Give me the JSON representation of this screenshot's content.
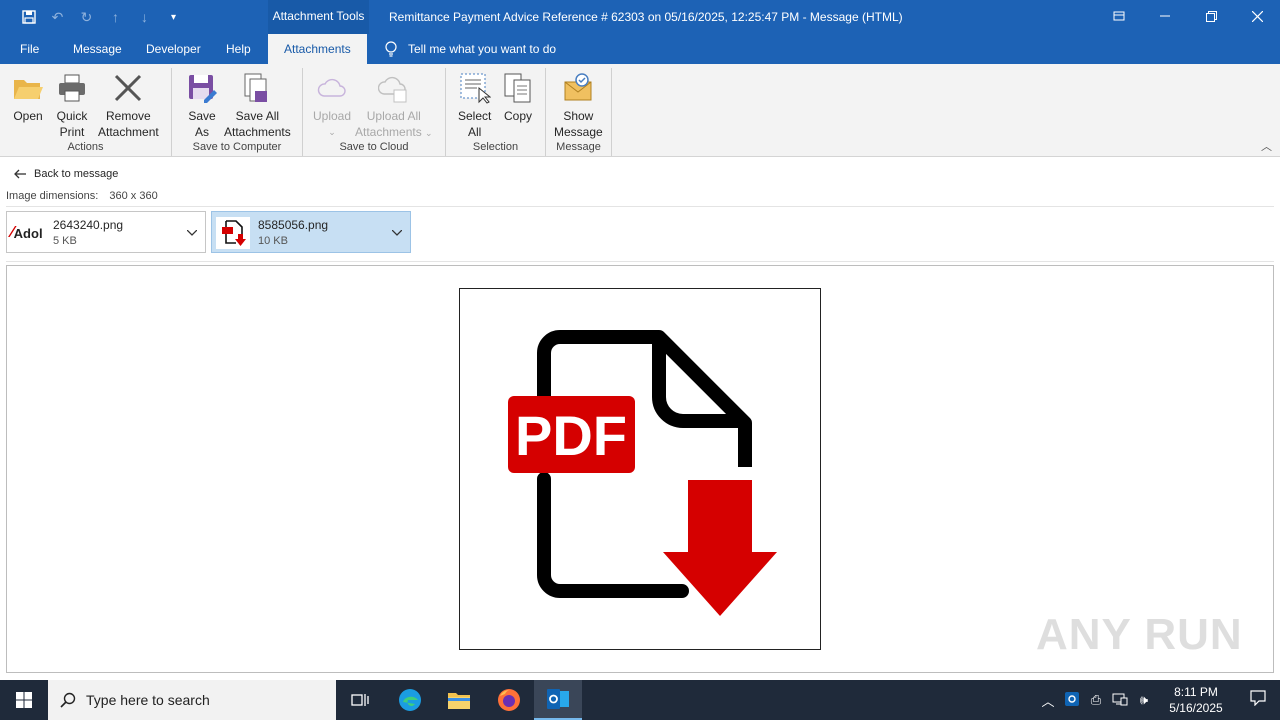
{
  "titlebar": {
    "context_group": "Attachment Tools",
    "title": "Remittance Payment Advice Reference # 62303 on 05/16/2025, 12:25:47 PM  -  Message (HTML)"
  },
  "tabs": {
    "file": "File",
    "message": "Message",
    "developer": "Developer",
    "help": "Help",
    "attachments": "Attachments",
    "tell_me": "Tell me what you want to do"
  },
  "ribbon": {
    "actions": {
      "label": "Actions",
      "open": "Open",
      "quick_print": [
        "Quick",
        "Print"
      ],
      "remove": [
        "Remove",
        "Attachment"
      ]
    },
    "save_to_computer": {
      "label": "Save to Computer",
      "save_as": [
        "Save",
        "As"
      ],
      "save_all": [
        "Save All",
        "Attachments"
      ]
    },
    "save_to_cloud": {
      "label": "Save to Cloud",
      "upload": "Upload",
      "upload_all": [
        "Upload All",
        "Attachments"
      ]
    },
    "selection": {
      "label": "Selection",
      "select_all": [
        "Select",
        "All"
      ],
      "copy": "Copy"
    },
    "message_group": {
      "label": "Message",
      "show_message": [
        "Show",
        "Message"
      ]
    }
  },
  "content": {
    "back_link": "Back to message",
    "dims_label": "Image dimensions:",
    "dims_value": "360 x 360",
    "attachments": [
      {
        "thumb_text": "Adol",
        "name": "2643240.png",
        "size": "5 KB"
      },
      {
        "thumb_text": "PDF",
        "name": "8585056.png",
        "size": "10 KB"
      }
    ],
    "preview_image_text": "PDF",
    "watermark": "ANY RUN"
  },
  "taskbar": {
    "search_placeholder": "Type here to search",
    "time": "8:11 PM",
    "date": "5/16/2025"
  },
  "colors": {
    "accent": "#1d62b5",
    "pdf_red": "#d50000"
  }
}
